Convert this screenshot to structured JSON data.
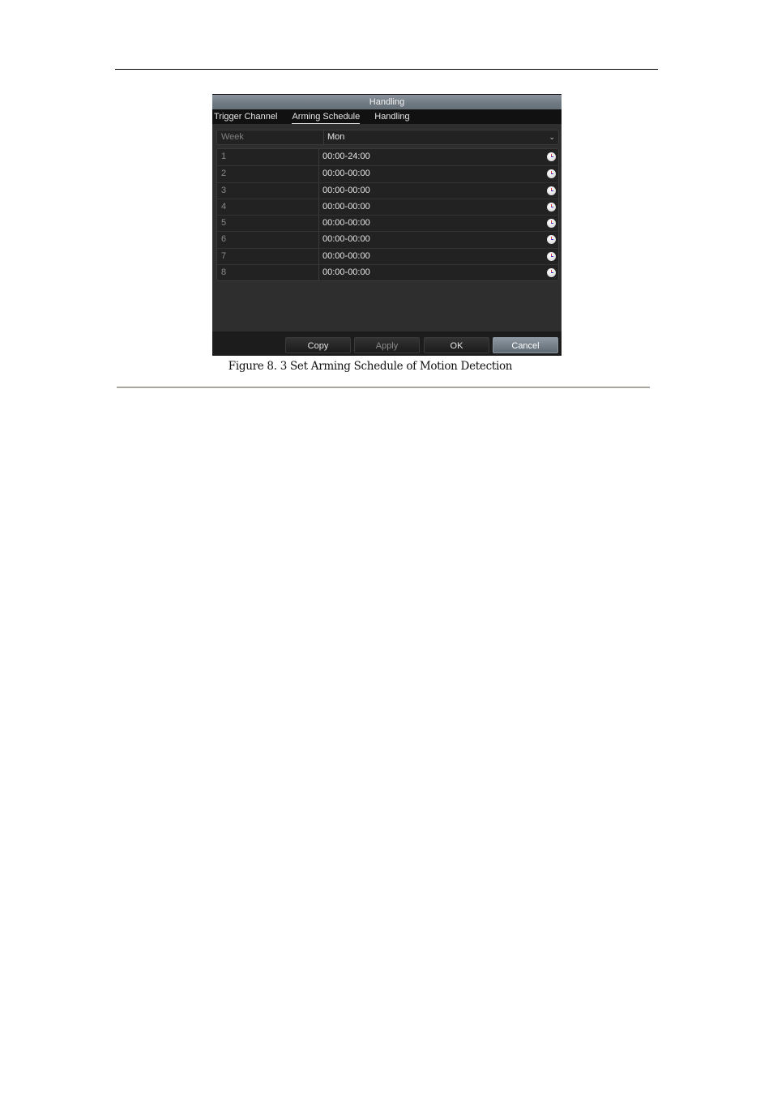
{
  "dialog": {
    "title": "Handling",
    "tabs": [
      {
        "label": "Trigger Channel",
        "active": false
      },
      {
        "label": "Arming Schedule",
        "active": true
      },
      {
        "label": "Handling",
        "active": false
      }
    ],
    "week": {
      "label": "Week",
      "value": "Mon",
      "icon": "chevron-down-icon"
    },
    "schedule": [
      {
        "num": "1",
        "time": "00:00-24:00",
        "icon": "clock-icon"
      },
      {
        "num": "2",
        "time": "00:00-00:00",
        "icon": "clock-icon"
      },
      {
        "num": "3",
        "time": "00:00-00:00",
        "icon": "clock-icon"
      },
      {
        "num": "4",
        "time": "00:00-00:00",
        "icon": "clock-icon"
      },
      {
        "num": "5",
        "time": "00:00-00:00",
        "icon": "clock-icon"
      },
      {
        "num": "6",
        "time": "00:00-00:00",
        "icon": "clock-icon"
      },
      {
        "num": "7",
        "time": "00:00-00:00",
        "icon": "clock-icon"
      },
      {
        "num": "8",
        "time": "00:00-00:00",
        "icon": "clock-icon"
      }
    ],
    "buttons": {
      "copy": "Copy",
      "apply": "Apply",
      "ok": "OK",
      "cancel": "Cancel"
    }
  },
  "caption": "Figure 8. 3  Set Arming Schedule of Motion Detection"
}
